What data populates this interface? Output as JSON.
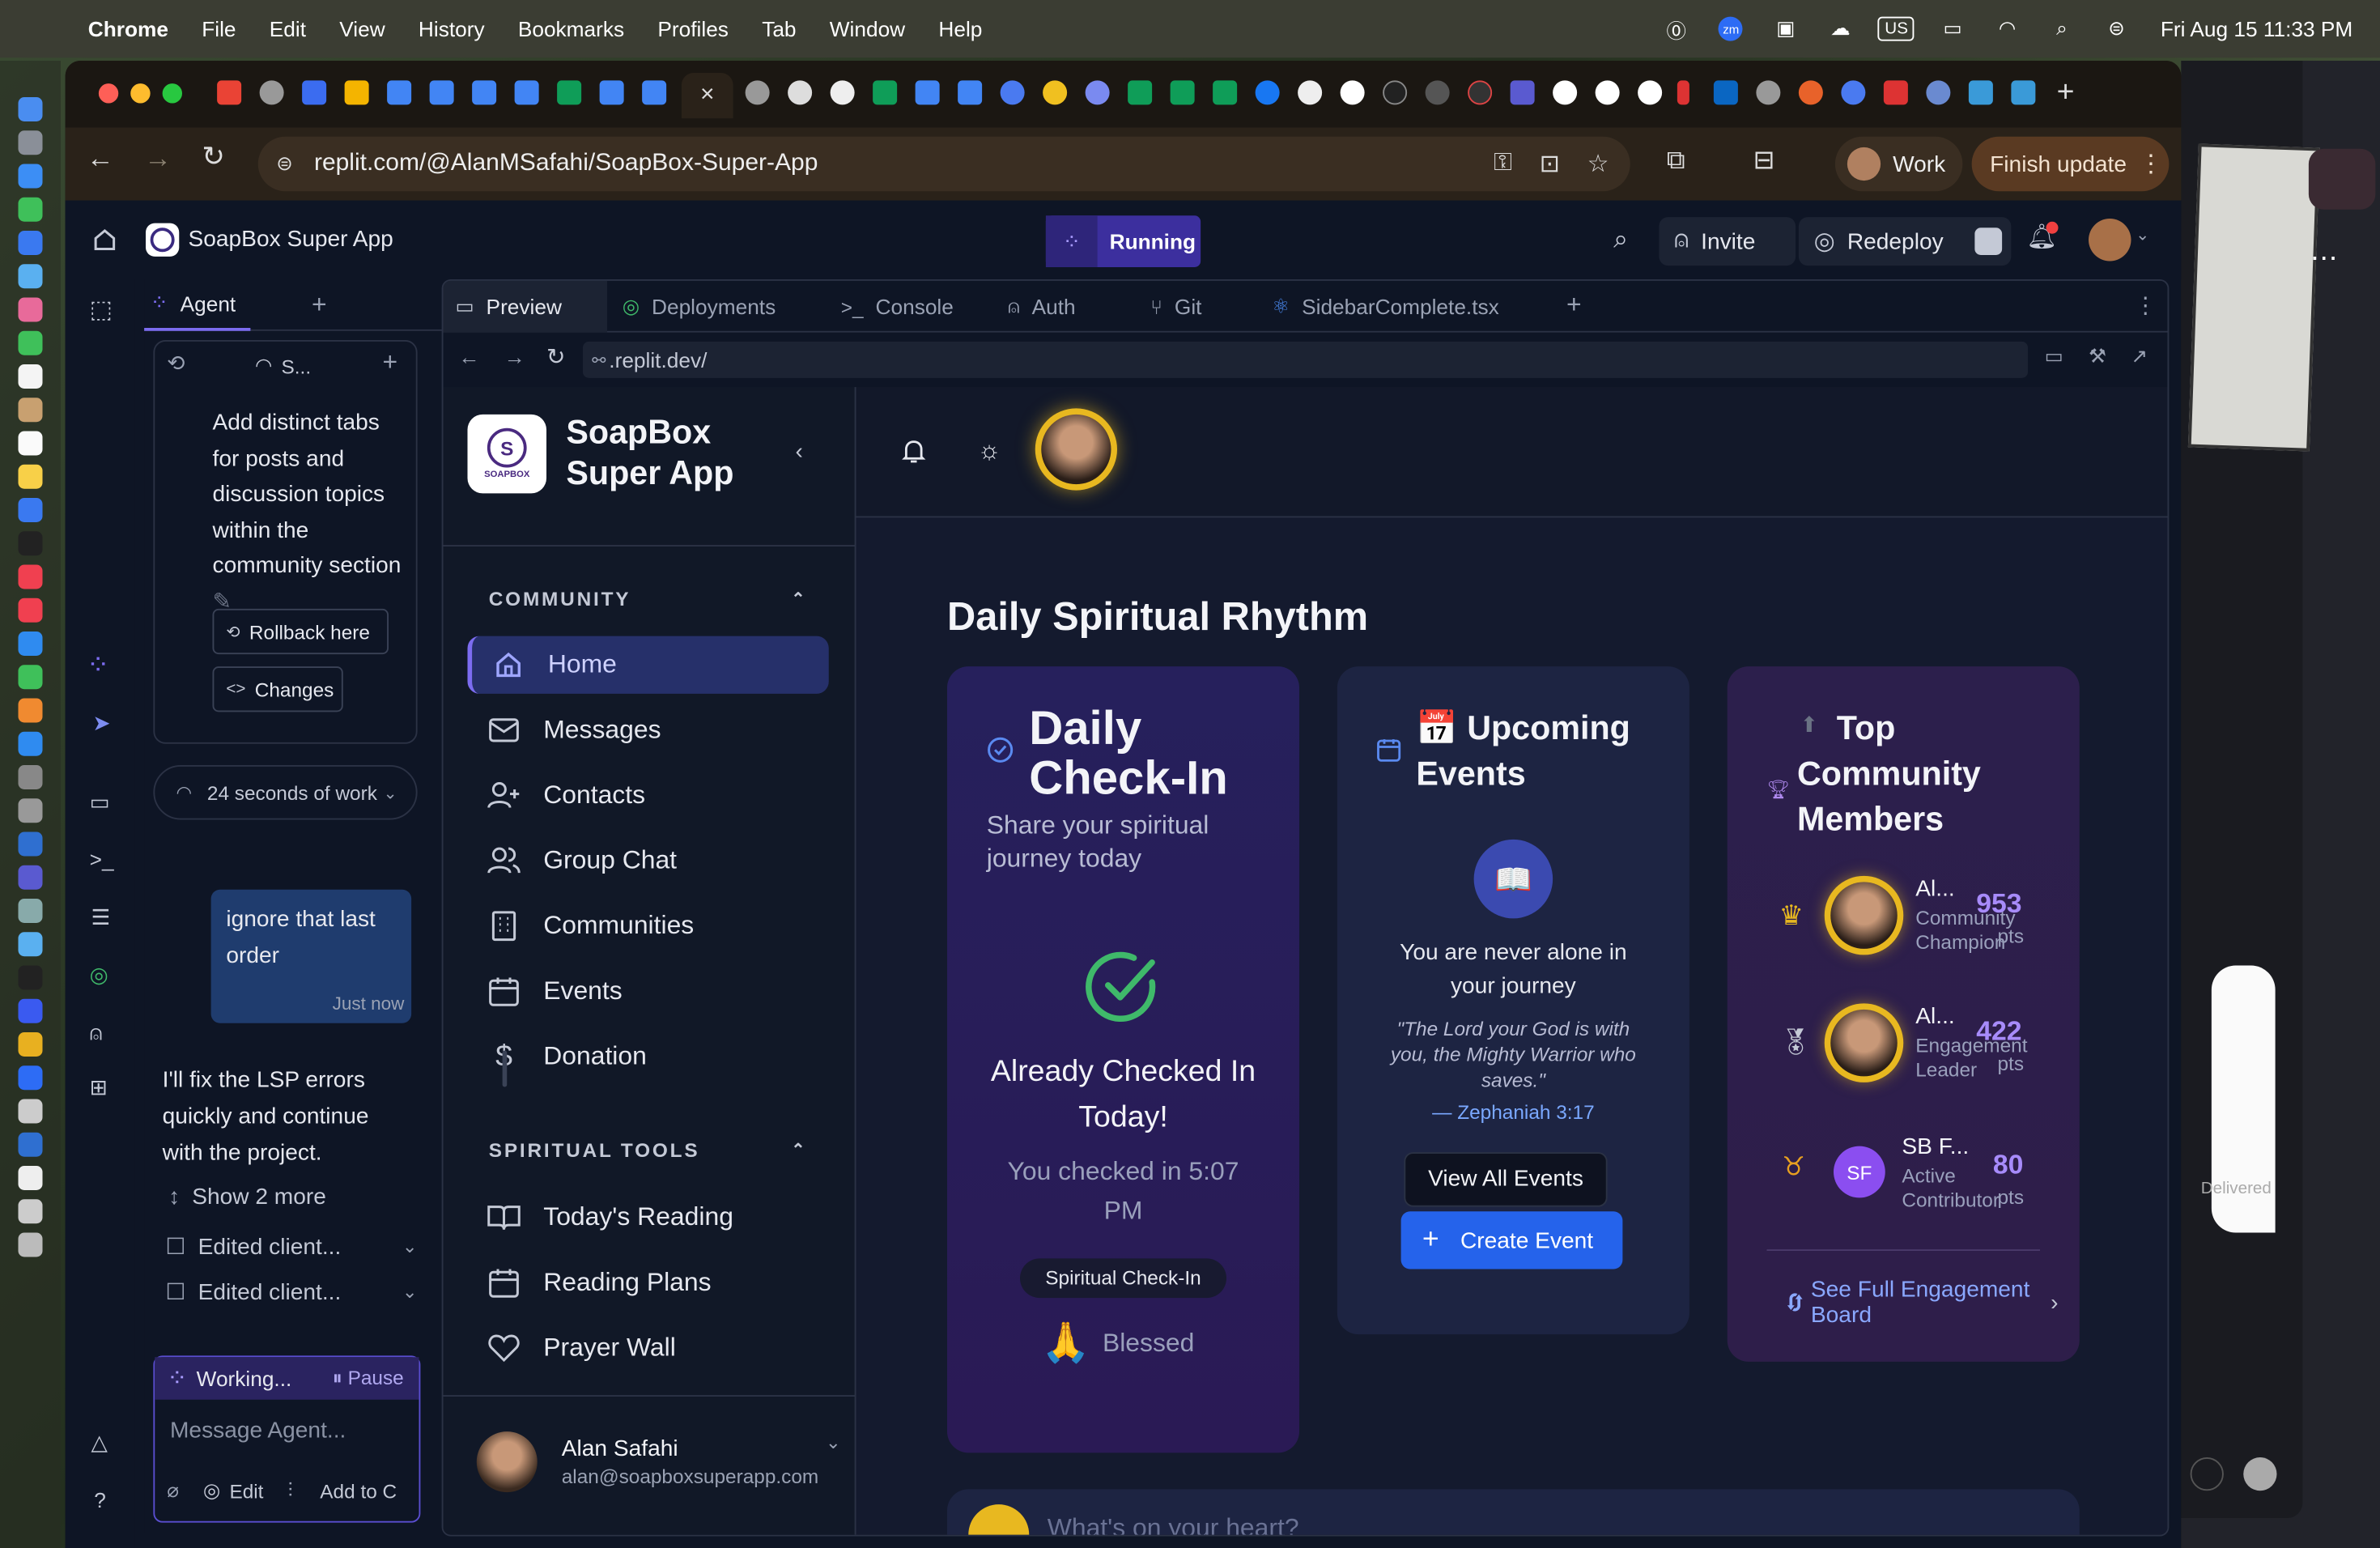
{
  "menubar": {
    "app": "Chrome",
    "items": [
      "File",
      "Edit",
      "View",
      "History",
      "Bookmarks",
      "Profiles",
      "Tab",
      "Window",
      "Help"
    ],
    "region": "US",
    "datetime": "Fri Aug 15  11:33 PM"
  },
  "browser": {
    "url": "replit.com/@AlanMSafahi/SoapBox-Super-App",
    "profile_label": "Work",
    "update_label": "Finish update"
  },
  "replit": {
    "project_name": "SoapBox Super App",
    "run_status": "Running",
    "invite_label": "Invite",
    "redeploy_label": "Redeploy",
    "agent_tab": "Agent",
    "session_label": "S...",
    "agent_message": "Add distinct tabs for posts and discussion topics within the community section",
    "rollback_label": "Rollback here",
    "changes_label": "Changes",
    "work_time": "24 seconds of work",
    "user_bubble": "ignore that last order",
    "user_time": "Just now",
    "agent_reply": "I'll fix the LSP errors quickly and continue with the project.",
    "show_more": "Show 2 more",
    "edited_1": "Edited client...",
    "edited_2": "Edited client...",
    "working_label": "Working...",
    "pause_label": "Pause",
    "message_placeholder": "Message Agent...",
    "edit_label": "Edit",
    "add_label": "Add to C",
    "workspace_tabs": [
      "Preview",
      "Deployments",
      "Console",
      "Auth",
      "Git",
      "SidebarComplete.tsx"
    ],
    "preview_url": ".replit.dev/"
  },
  "app": {
    "logo_text": "SOAPBOX",
    "title_line1": "SoapBox",
    "title_line2": "Super App",
    "section_community": "COMMUNITY",
    "community_items": [
      "Home",
      "Messages",
      "Contacts",
      "Group Chat",
      "Communities",
      "Events",
      "Donation"
    ],
    "section_tools": "SPIRITUAL TOOLS",
    "tools_items": [
      "Today's Reading",
      "Reading Plans",
      "Prayer Wall"
    ],
    "user_name": "Alan Safahi",
    "user_email": "alan@soapboxsuperapp.com",
    "heading": "Daily Spiritual Rhythm",
    "checkin": {
      "title_1": "Daily",
      "title_2": "Check-In",
      "subtitle": "Share your spiritual journey today",
      "status_1": "Already Checked In",
      "status_2": "Today!",
      "time_1": "You checked in 5:07",
      "time_2": "PM",
      "badge": "Spiritual Check-In",
      "mood": "Blessed"
    },
    "events": {
      "title_1": "📅 Upcoming",
      "title_2": "Events",
      "empty_1": "You are never alone in",
      "empty_2": "your journey",
      "verse_1": "\"The Lord your God is with",
      "verse_2": "you, the Mighty Warrior who",
      "verse_3": "saves.\"",
      "reference": "— Zephaniah 3:17",
      "view_all": "View All Events",
      "create": "Create Event"
    },
    "leaders": {
      "title_1": "Top",
      "title_2": "Community",
      "title_3": "Members",
      "members": [
        {
          "name": "Al...",
          "role_1": "Community",
          "role_2": "Champion",
          "points": "953",
          "pts": "pts"
        },
        {
          "name": "Al...",
          "role_1": "Engagement",
          "role_2": "Leader",
          "points": "422",
          "pts": "pts"
        },
        {
          "name": "SB F...",
          "initials": "SF",
          "role_1": "Active",
          "role_2": "Contributor",
          "points": "80",
          "pts": "pts"
        }
      ],
      "see_full": "See Full Engagement Board"
    },
    "composer_placeholder": "What's on your heart?"
  },
  "right_panel": {
    "delivered": "Delivered"
  },
  "colors": {
    "accent": "#7c6cf0",
    "gold": "#e8b820",
    "card_purple": "#2a1d5a",
    "card_navy": "#1d2442",
    "card_plum": "#2e1f4d",
    "create_btn": "#2563eb",
    "check_green": "#3fb96a",
    "running": "#5b4ee0"
  }
}
